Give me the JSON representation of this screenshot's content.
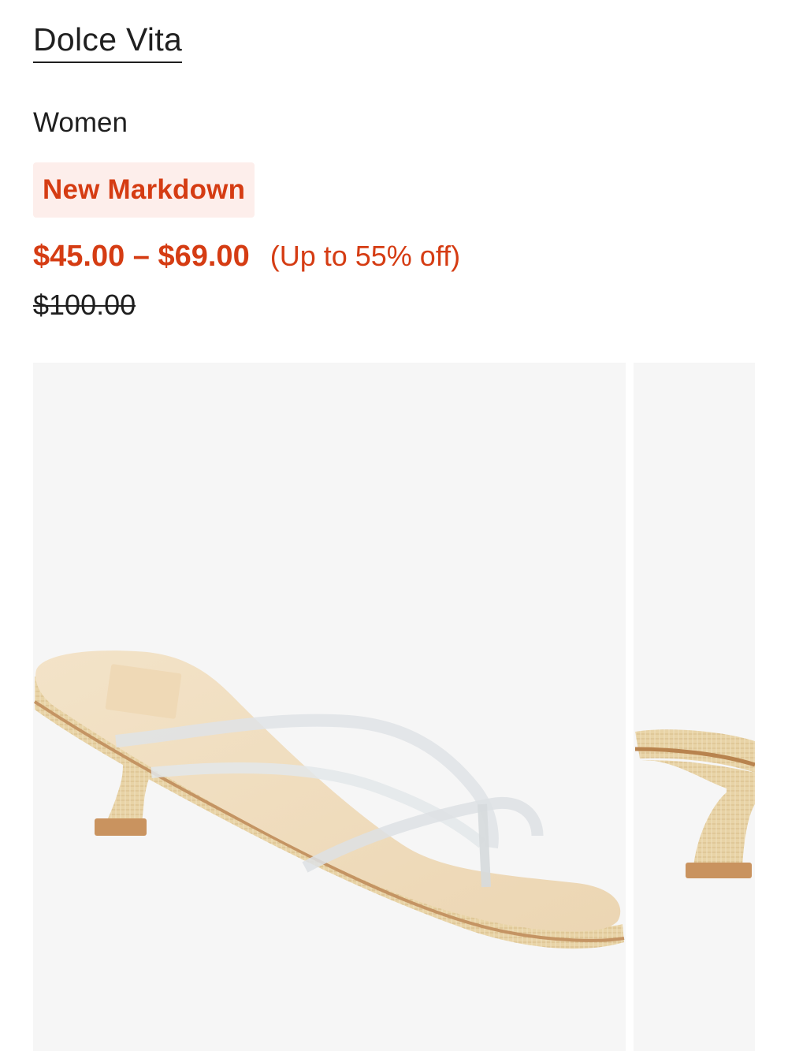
{
  "product": {
    "brand": "Dolce Vita",
    "category": "Women",
    "badge": "New Markdown",
    "price_range": "$45.00 – $69.00",
    "discount": "(Up to 55% off)",
    "original_price": "$100.00"
  },
  "colors": {
    "sale_red": "#d53c13",
    "badge_bg": "#fdeeeb",
    "text": "#1f1f1f",
    "image_bg": "#f6f6f6"
  },
  "gallery": {
    "images": [
      {
        "name": "product-image-main",
        "subject": "raffia kitten-heel thong sandal with clear straps, three-quarter view"
      },
      {
        "name": "product-image-next",
        "subject": "sandal heel side view (partially visible)"
      }
    ]
  }
}
